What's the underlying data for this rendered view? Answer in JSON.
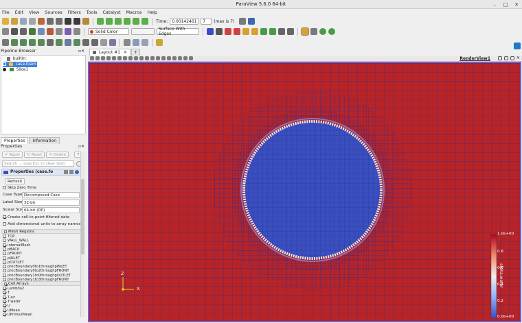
{
  "window": {
    "title": "ParaView 5.6.0 64-bit"
  },
  "menu": [
    "File",
    "Edit",
    "View",
    "Sources",
    "Filters",
    "Tools",
    "Catalyst",
    "Macros",
    "Help"
  ],
  "toolbar": {
    "time_label": "Time:",
    "time_value": "0.00142461",
    "timestep": "7",
    "max_text": "(max is 7)",
    "coloring": "Solid Color",
    "representation": "Surface With Edges"
  },
  "pipeline": {
    "title": "Pipeline Browser",
    "items": [
      {
        "label": "builtin:"
      },
      {
        "label": "case.foam"
      },
      {
        "label": "Slice1"
      }
    ]
  },
  "props": {
    "tabs": [
      "Properties",
      "Information"
    ],
    "section_title": "Properties",
    "apply": "Apply",
    "reset": "Reset",
    "delete": "Delete",
    "help": "?",
    "search_placeholder": "Search ... (use Esc to clear text)",
    "group_title": "Properties (case.fo",
    "refresh": "Refresh",
    "skip_zero_time": "Skip Zero Time",
    "case_type_label": "Case Type",
    "case_type": "Decomposed Case",
    "label_size_label": "Label Size",
    "label_size": "32-bit",
    "scalar_size_label": "Scalar Size",
    "scalar_size": "64-bit (DP)",
    "create_cell": "Create cell-to-point filtered data",
    "add_units": "Add dimensional units to array names",
    "mesh_regions_header": "Mesh Regions",
    "mesh_regions": [
      {
        "label": "TOP",
        "checked": false
      },
      {
        "label": "WALL_WALL",
        "checked": false
      },
      {
        "label": "internalMesh",
        "checked": true
      },
      {
        "label": "pBACK",
        "checked": false
      },
      {
        "label": "pFRONT",
        "checked": false
      },
      {
        "label": "pINLET",
        "checked": false
      },
      {
        "label": "pOUTLET",
        "checked": false
      },
      {
        "label": "procBoundary0to1throughpINLET",
        "checked": false
      },
      {
        "label": "procBoundary0to2throughpFRONT",
        "checked": false
      },
      {
        "label": "procBoundary1to0throughpOUTLET",
        "checked": false
      },
      {
        "label": "procBoundary1to3throughpFRONT",
        "checked": false
      }
    ],
    "cell_arrays_header": "Cell Arrays",
    "cell_arrays": [
      {
        "label": "Lambda2",
        "checked": true
      },
      {
        "label": "T",
        "checked": true
      },
      {
        "label": "T.air",
        "checked": true
      },
      {
        "label": "T.water",
        "checked": true
      },
      {
        "label": "U",
        "checked": true
      },
      {
        "label": "UMean",
        "checked": true
      },
      {
        "label": "UPrime2Mean",
        "checked": true
      }
    ]
  },
  "layout": {
    "tab": "Layout #1",
    "add": "+",
    "view_name": "RenderView1"
  },
  "colorbar": {
    "max": "1.0e+00",
    "ticks": [
      "0.8",
      "0.6",
      "0.4",
      "0.2"
    ],
    "min": "0.0e+00",
    "title": "alpha.water"
  },
  "axes": {
    "x": "X",
    "z": "Z"
  },
  "colors": {
    "field": "#b62428",
    "bubble": "#3a4fbd",
    "edge": "#1d2a9c",
    "accent": "#7b5ccc"
  }
}
